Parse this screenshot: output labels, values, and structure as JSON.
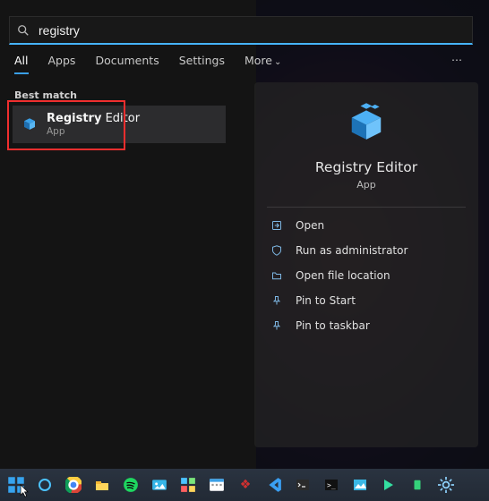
{
  "search": {
    "value": "registry"
  },
  "tabs": {
    "all": "All",
    "apps": "Apps",
    "documents": "Documents",
    "settings": "Settings",
    "more": "More"
  },
  "more_icon": "⋯",
  "best_match_label": "Best match",
  "result": {
    "title_bold": "Registry",
    "title_rest": " Editor",
    "subtitle": "App"
  },
  "detail": {
    "title": "Registry Editor",
    "subtitle": "App",
    "actions": {
      "open": "Open",
      "run_admin": "Run as administrator",
      "open_loc": "Open file location",
      "pin_start": "Pin to Start",
      "pin_taskbar": "Pin to taskbar"
    }
  },
  "taskbar": {
    "start": "start",
    "cortana": "cortana",
    "chrome": "chrome",
    "explorer": "file-explorer",
    "spotify": "spotify",
    "photos": "photos",
    "widgets": "widgets",
    "calendar": "calendar",
    "diablo": "game",
    "vscode": "vscode",
    "terminal": "terminal",
    "cmd": "command-prompt",
    "img": "image-viewer",
    "play": "play-store",
    "android": "android-app",
    "settings": "settings"
  }
}
